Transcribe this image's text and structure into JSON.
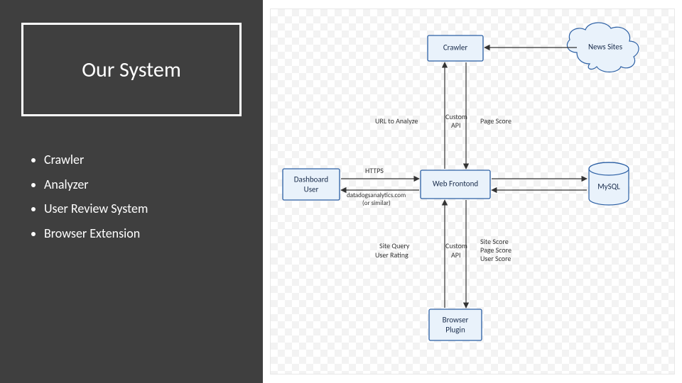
{
  "title": "Our System",
  "bullets": [
    "Crawler",
    "Analyzer",
    "User Review System",
    "Browser Extension"
  ],
  "diagram": {
    "nodes": {
      "crawler": {
        "label": "Crawler"
      },
      "news_sites": {
        "label": "News Sites"
      },
      "dashboard": {
        "label": "Dashboard",
        "label2": "User"
      },
      "web_frontend": {
        "label": "Web Frontond"
      },
      "mysql": {
        "label": "MySQL"
      },
      "browser": {
        "label": "Browser",
        "label2": "Plugin"
      }
    },
    "edge_labels": {
      "url_to_analyze": "URL to Analyze",
      "custom_api_top": "Custom",
      "custom_api_top2": "API",
      "page_score": "Page Score",
      "https": "HTTPS",
      "domain1": "datadogsanalytics.com",
      "domain2": "(or similar)",
      "site_query": "Site Query",
      "user_rating": "User Rating",
      "custom_api_bot": "Custom",
      "custom_api_bot2": "API",
      "site_score": "Site Score",
      "page_score2": "Page Score",
      "user_score": "User Score"
    }
  }
}
